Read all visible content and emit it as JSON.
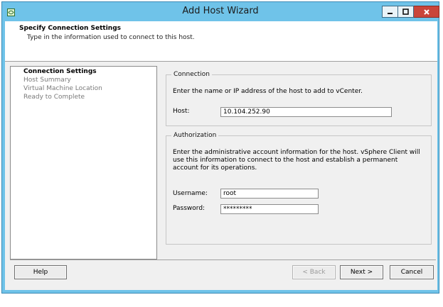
{
  "window": {
    "title": "Add Host Wizard",
    "controls": {
      "minimize": "_",
      "maximize": "□",
      "close": "x"
    },
    "colors": {
      "frame": "#6fc3e9",
      "close_button": "#c9453a"
    }
  },
  "header": {
    "title": "Specify Connection Settings",
    "subtitle": "Type in the information used to connect to this host."
  },
  "steps": [
    {
      "label": "Connection Settings",
      "active": true
    },
    {
      "label": "Host Summary",
      "active": false
    },
    {
      "label": "Virtual Machine Location",
      "active": false
    },
    {
      "label": "Ready to Complete",
      "active": false
    }
  ],
  "connection": {
    "legend": "Connection",
    "description": "Enter the name or IP address of the host to add to vCenter.",
    "host_label": "Host:",
    "host_value": "10.104.252.90"
  },
  "authorization": {
    "legend": "Authorization",
    "description_lines": [
      "Enter the administrative account information for the host. vSphere Client will",
      "use this information to connect to the host and establish a permanent",
      "account for its operations."
    ],
    "username_label": "Username:",
    "username_value": "root",
    "password_label": "Password:",
    "password_value": "*********"
  },
  "buttons": {
    "help": "Help",
    "back": "< Back",
    "next": "Next >",
    "cancel": "Cancel"
  }
}
